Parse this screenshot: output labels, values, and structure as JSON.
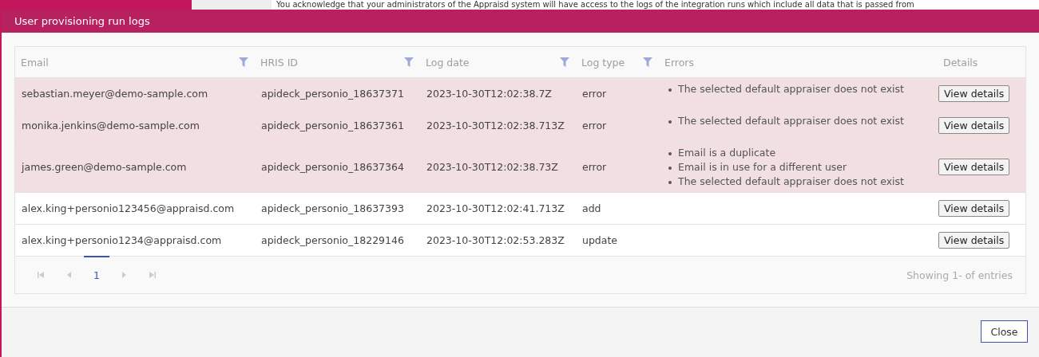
{
  "background": {
    "notice": "You acknowledge that your administrators of the Appraisd system will have access to the logs of the integration runs which include all data that is passed from"
  },
  "dialog": {
    "title": "User provisioning run logs",
    "table": {
      "columns": [
        {
          "label": "Email",
          "filter": true
        },
        {
          "label": "HRIS ID",
          "filter": true
        },
        {
          "label": "Log date",
          "filter": true
        },
        {
          "label": "Log type",
          "filter": true
        },
        {
          "label": "Errors",
          "filter": false
        },
        {
          "label": "Details",
          "filter": false
        }
      ],
      "rows": [
        {
          "email": "sebastian.meyer@demo-sample.com",
          "hris_id": "apideck_personio_18637371",
          "log_date": "2023-10-30T12:02:38.7Z",
          "log_type": "error",
          "failed": true,
          "errors": [
            "The selected default appraiser does not exist"
          ],
          "action": "View details"
        },
        {
          "email": "monika.jenkins@demo-sample.com",
          "hris_id": "apideck_personio_18637361",
          "log_date": "2023-10-30T12:02:38.713Z",
          "log_type": "error",
          "failed": true,
          "errors": [
            "The selected default appraiser does not exist"
          ],
          "action": "View details"
        },
        {
          "email": "james.green@demo-sample.com",
          "hris_id": "apideck_personio_18637364",
          "log_date": "2023-10-30T12:02:38.73Z",
          "log_type": "error",
          "failed": true,
          "errors": [
            "Email is a duplicate",
            "Email is in use for a different user",
            "The selected default appraiser does not exist"
          ],
          "action": "View details"
        },
        {
          "email": "alex.king+personio123456@appraisd.com",
          "hris_id": "apideck_personio_18637393",
          "log_date": "2023-10-30T12:02:41.713Z",
          "log_type": "add",
          "failed": false,
          "errors": [],
          "action": "View details"
        },
        {
          "email": "alex.king+personio1234@appraisd.com",
          "hris_id": "apideck_personio_18229146",
          "log_date": "2023-10-30T12:02:53.283Z",
          "log_type": "update",
          "failed": false,
          "errors": [],
          "action": "View details"
        }
      ]
    },
    "pager": {
      "pages": [
        {
          "label": "1",
          "selected": true
        }
      ],
      "summary": "Showing 1- of entries"
    },
    "buttons": [
      "Close"
    ]
  }
}
